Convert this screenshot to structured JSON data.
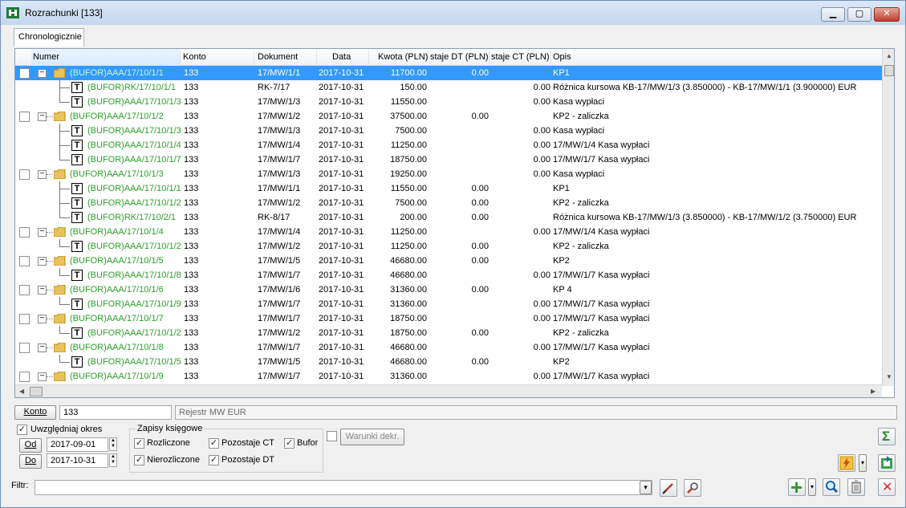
{
  "window": {
    "title": "Rozrachunki [133]",
    "minimize": "▁",
    "maximize": "▢",
    "close": "✕"
  },
  "tabs": [
    {
      "label": "Chronologicznie"
    }
  ],
  "columns": [
    "Numer",
    "Konto",
    "Dokument",
    "Data",
    "Kwota (PLN)",
    "staje DT (PLN)",
    "staje CT (PLN)",
    "Opis"
  ],
  "rows": [
    {
      "level": 0,
      "selected": true,
      "numer": "(BUFOR)AAA/17/10/1/1",
      "konto": "133",
      "dokument": "17/MW/1/1",
      "data": "2017-10-31",
      "kwota": "11700.00",
      "dt": "0.00",
      "ct": "",
      "opis": "KP1"
    },
    {
      "level": 1,
      "numer": "(BUFOR)RK/17/10/1/1",
      "konto": "133",
      "dokument": "RK-7/17",
      "data": "2017-10-31",
      "kwota": "150.00",
      "dt": "",
      "ct": "0.00",
      "opis": "Różnica kursowa KB-17/MW/1/3 (3.850000) - KB-17/MW/1/1 (3.900000) EUR"
    },
    {
      "level": 1,
      "last": true,
      "numer": "(BUFOR)AAA/17/10/1/3",
      "konto": "133",
      "dokument": "17/MW/1/3",
      "data": "2017-10-31",
      "kwota": "11550.00",
      "dt": "",
      "ct": "0.00",
      "opis": "Kasa wypłaci"
    },
    {
      "level": 0,
      "numer": "(BUFOR)AAA/17/10/1/2",
      "konto": "133",
      "dokument": "17/MW/1/2",
      "data": "2017-10-31",
      "kwota": "37500.00",
      "dt": "0.00",
      "ct": "",
      "opis": "KP2 - zaliczka"
    },
    {
      "level": 1,
      "numer": "(BUFOR)AAA/17/10/1/3",
      "konto": "133",
      "dokument": "17/MW/1/3",
      "data": "2017-10-31",
      "kwota": "7500.00",
      "dt": "",
      "ct": "0.00",
      "opis": "Kasa wypłaci"
    },
    {
      "level": 1,
      "numer": "(BUFOR)AAA/17/10/1/4",
      "konto": "133",
      "dokument": "17/MW/1/4",
      "data": "2017-10-31",
      "kwota": "11250.00",
      "dt": "",
      "ct": "0.00",
      "opis": "17/MW/1/4 Kasa wypłaci"
    },
    {
      "level": 1,
      "last": true,
      "numer": "(BUFOR)AAA/17/10/1/7",
      "konto": "133",
      "dokument": "17/MW/1/7",
      "data": "2017-10-31",
      "kwota": "18750.00",
      "dt": "",
      "ct": "0.00",
      "opis": "17/MW/1/7 Kasa wypłaci"
    },
    {
      "level": 0,
      "numer": "(BUFOR)AAA/17/10/1/3",
      "konto": "133",
      "dokument": "17/MW/1/3",
      "data": "2017-10-31",
      "kwota": "19250.00",
      "dt": "",
      "ct": "0.00",
      "opis": "Kasa wypłaci"
    },
    {
      "level": 1,
      "numer": "(BUFOR)AAA/17/10/1/1",
      "konto": "133",
      "dokument": "17/MW/1/1",
      "data": "2017-10-31",
      "kwota": "11550.00",
      "dt": "0.00",
      "ct": "",
      "opis": "KP1"
    },
    {
      "level": 1,
      "numer": "(BUFOR)AAA/17/10/1/2",
      "konto": "133",
      "dokument": "17/MW/1/2",
      "data": "2017-10-31",
      "kwota": "7500.00",
      "dt": "0.00",
      "ct": "",
      "opis": "KP2 - zaliczka"
    },
    {
      "level": 1,
      "last": true,
      "numer": "(BUFOR)RK/17/10/2/1",
      "konto": "133",
      "dokument": "RK-8/17",
      "data": "2017-10-31",
      "kwota": "200.00",
      "dt": "0.00",
      "ct": "",
      "opis": "Różnica kursowa KB-17/MW/1/3 (3.850000) - KB-17/MW/1/2 (3.750000) EUR"
    },
    {
      "level": 0,
      "numer": "(BUFOR)AAA/17/10/1/4",
      "konto": "133",
      "dokument": "17/MW/1/4",
      "data": "2017-10-31",
      "kwota": "11250.00",
      "dt": "",
      "ct": "0.00",
      "opis": "17/MW/1/4 Kasa wypłaci"
    },
    {
      "level": 1,
      "last": true,
      "numer": "(BUFOR)AAA/17/10/1/2",
      "konto": "133",
      "dokument": "17/MW/1/2",
      "data": "2017-10-31",
      "kwota": "11250.00",
      "dt": "0.00",
      "ct": "",
      "opis": "KP2 - zaliczka"
    },
    {
      "level": 0,
      "numer": "(BUFOR)AAA/17/10/1/5",
      "konto": "133",
      "dokument": "17/MW/1/5",
      "data": "2017-10-31",
      "kwota": "46680.00",
      "dt": "0.00",
      "ct": "",
      "opis": "KP2"
    },
    {
      "level": 1,
      "last": true,
      "numer": "(BUFOR)AAA/17/10/1/8",
      "konto": "133",
      "dokument": "17/MW/1/7",
      "data": "2017-10-31",
      "kwota": "46680.00",
      "dt": "",
      "ct": "0.00",
      "opis": "17/MW/1/7 Kasa wypłaci"
    },
    {
      "level": 0,
      "numer": "(BUFOR)AAA/17/10/1/6",
      "konto": "133",
      "dokument": "17/MW/1/6",
      "data": "2017-10-31",
      "kwota": "31360.00",
      "dt": "0.00",
      "ct": "",
      "opis": "KP 4"
    },
    {
      "level": 1,
      "last": true,
      "numer": "(BUFOR)AAA/17/10/1/9",
      "konto": "133",
      "dokument": "17/MW/1/7",
      "data": "2017-10-31",
      "kwota": "31360.00",
      "dt": "",
      "ct": "0.00",
      "opis": "17/MW/1/7 Kasa wypłaci"
    },
    {
      "level": 0,
      "numer": "(BUFOR)AAA/17/10/1/7",
      "konto": "133",
      "dokument": "17/MW/1/7",
      "data": "2017-10-31",
      "kwota": "18750.00",
      "dt": "",
      "ct": "0.00",
      "opis": "17/MW/1/7 Kasa wypłaci"
    },
    {
      "level": 1,
      "last": true,
      "numer": "(BUFOR)AAA/17/10/1/2",
      "konto": "133",
      "dokument": "17/MW/1/2",
      "data": "2017-10-31",
      "kwota": "18750.00",
      "dt": "0.00",
      "ct": "",
      "opis": "KP2 - zaliczka"
    },
    {
      "level": 0,
      "numer": "(BUFOR)AAA/17/10/1/8",
      "konto": "133",
      "dokument": "17/MW/1/7",
      "data": "2017-10-31",
      "kwota": "46680.00",
      "dt": "",
      "ct": "0.00",
      "opis": "17/MW/1/7 Kasa wypłaci"
    },
    {
      "level": 1,
      "last": true,
      "numer": "(BUFOR)AAA/17/10/1/5",
      "konto": "133",
      "dokument": "17/MW/1/5",
      "data": "2017-10-31",
      "kwota": "46680.00",
      "dt": "0.00",
      "ct": "",
      "opis": "KP2"
    },
    {
      "level": 0,
      "numer": "(BUFOR)AAA/17/10/1/9",
      "konto": "133",
      "dokument": "17/MW/1/7",
      "data": "2017-10-31",
      "kwota": "31360.00",
      "dt": "",
      "ct": "0.00",
      "opis": "17/MW/1/7 Kasa wypłaci"
    }
  ],
  "konto": {
    "button": "Konto",
    "value": "133",
    "register_placeholder": "Rejestr MW EUR"
  },
  "okres": {
    "checkbox_label": "Uwzględniaj okres",
    "od_button": "Od",
    "od_value": "2017-09-01",
    "do_button": "Do",
    "do_value": "2017-10-31"
  },
  "zapisy": {
    "group_label": "Zapisy księgowe",
    "rozliczone": "Rozliczone",
    "nierozliczone": "Nierozliczone",
    "pozostaje_ct": "Pozostaje CT",
    "pozostaje_dt": "Pozostaje DT",
    "bufor": "Bufor"
  },
  "warunki": {
    "label": "Warunki dekr."
  },
  "filtr": {
    "label": "Filtr:",
    "value": ""
  },
  "icons": {
    "check": "✓",
    "expander": "−",
    "sum": "Σ",
    "add": "+",
    "dropdown": "▾",
    "close": "✕",
    "t_doc": "T"
  },
  "colors": {
    "selection": "#3399ff",
    "tree_text": "#2ca02c",
    "add_green": "#2a9d2a",
    "close_red": "#d62a2a",
    "sum_green": "#2a8a2a"
  }
}
